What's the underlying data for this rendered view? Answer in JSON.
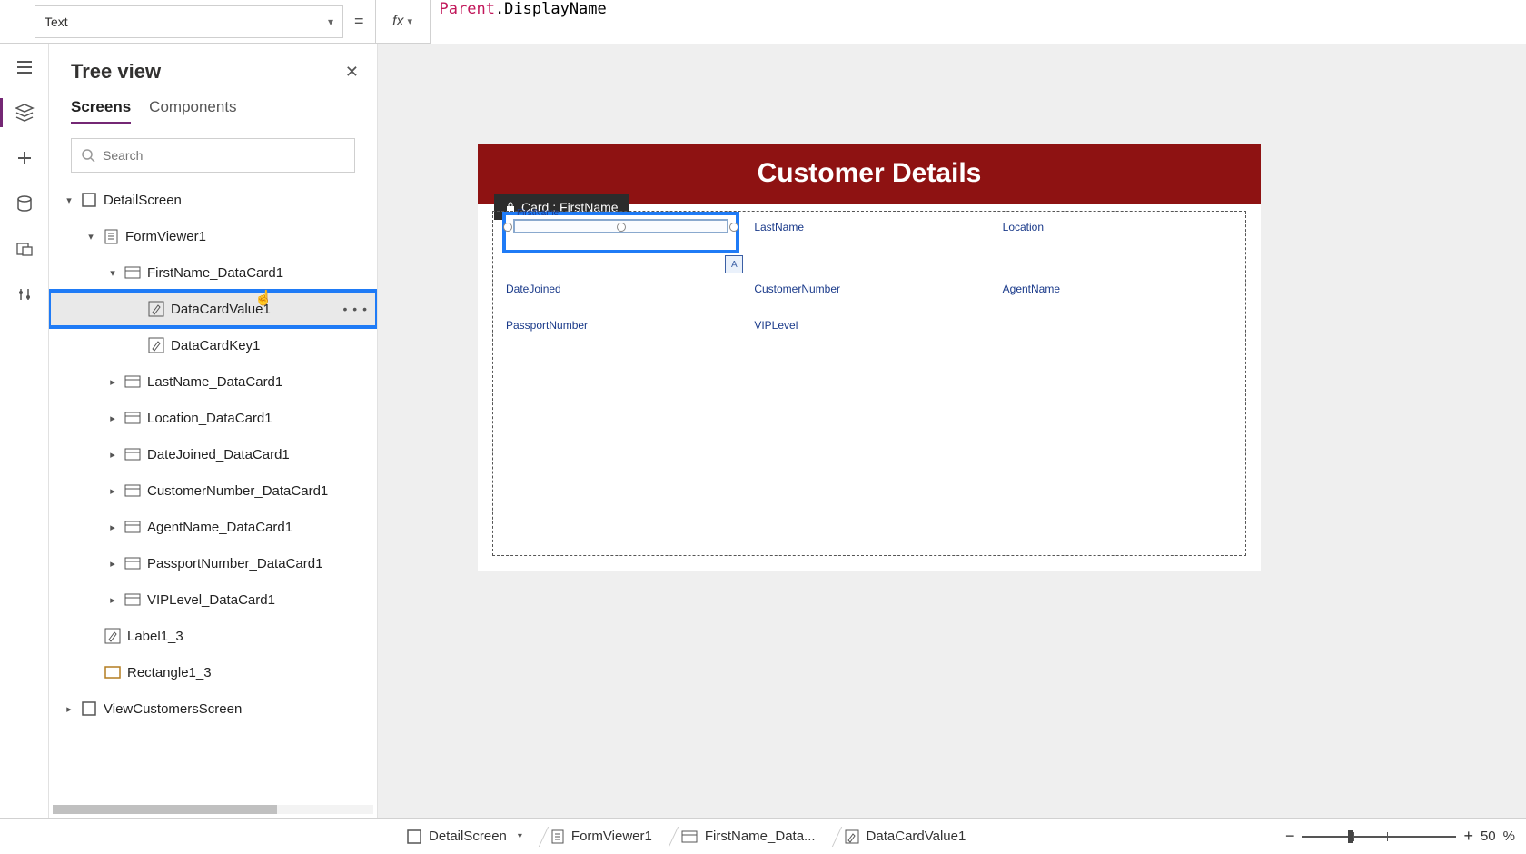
{
  "propertyBar": {
    "property": "Text",
    "fx_label": "fx",
    "formula_tok1": "Parent",
    "formula_tok2": ".DisplayName"
  },
  "treePanel": {
    "title": "Tree view",
    "tabs": {
      "screens": "Screens",
      "components": "Components"
    },
    "search_placeholder": "Search"
  },
  "tree": {
    "items": [
      {
        "label": "DetailScreen"
      },
      {
        "label": "FormViewer1"
      },
      {
        "label": "FirstName_DataCard1"
      },
      {
        "label": "DataCardValue1"
      },
      {
        "label": "DataCardKey1"
      },
      {
        "label": "LastName_DataCard1"
      },
      {
        "label": "Location_DataCard1"
      },
      {
        "label": "DateJoined_DataCard1"
      },
      {
        "label": "CustomerNumber_DataCard1"
      },
      {
        "label": "AgentName_DataCard1"
      },
      {
        "label": "PassportNumber_DataCard1"
      },
      {
        "label": "VIPLevel_DataCard1"
      },
      {
        "label": "Label1_3"
      },
      {
        "label": "Rectangle1_3"
      },
      {
        "label": "ViewCustomersScreen"
      }
    ]
  },
  "canvas": {
    "header_title": "Customer Details",
    "tooltip": "Card : FirstName",
    "fx_btn": "A",
    "fields": {
      "firstname": "FirstName",
      "lastname": "LastName",
      "location": "Location",
      "datejoined": "DateJoined",
      "customernumber": "CustomerNumber",
      "agentname": "AgentName",
      "passportnumber": "PassportNumber",
      "viplevel": "VIPLevel"
    }
  },
  "breadcrumb": {
    "items": [
      {
        "label": "DetailScreen"
      },
      {
        "label": "FormViewer1"
      },
      {
        "label": "FirstName_Data..."
      },
      {
        "label": "DataCardValue1"
      }
    ]
  },
  "zoom": {
    "value": "50",
    "suffix": " %"
  },
  "colors": {
    "accent": "#742774",
    "selectionBlue": "#1f7bf6",
    "headerRed": "#8e1212",
    "labelBlue": "#1a3a8a"
  }
}
